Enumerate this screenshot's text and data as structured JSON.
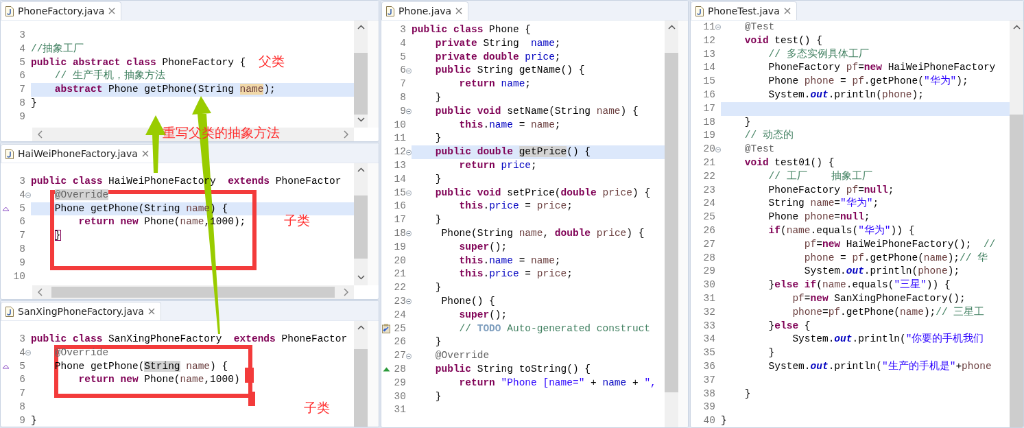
{
  "editors": [
    {
      "tab": {
        "label": "PhoneFactory.java",
        "selected": true
      },
      "lines": [
        {
          "number": "3",
          "current": false
        },
        {
          "number": "4",
          "current": false,
          "tokens": [
            {
              "kind": "comment",
              "text": "//抽象工厂"
            }
          ]
        },
        {
          "number": "5",
          "current": false,
          "tokens": [
            {
              "kind": "keyword",
              "text": "public abstract class"
            },
            {
              "kind": "plain",
              "text": " PhoneFactory {"
            }
          ]
        },
        {
          "number": "6",
          "current": false,
          "tokens": [
            {
              "kind": "comment",
              "text": "    // 生产手机，抽象方法"
            }
          ]
        },
        {
          "number": "7",
          "current": true,
          "tokens": [
            {
              "kind": "keyword",
              "text": "    abstract"
            },
            {
              "kind": "plain",
              "text": " Phone getPhone(String "
            },
            {
              "kind": "variable",
              "text": "name",
              "highlight": {
                "kind": "occurrence"
              }
            },
            {
              "kind": "plain",
              "text": ");"
            }
          ]
        },
        {
          "number": "8",
          "current": false,
          "tokens": [
            {
              "kind": "plain",
              "text": "}"
            }
          ]
        },
        {
          "number": "9",
          "current": false
        }
      ]
    },
    {
      "tab": {
        "label": "HaiWeiPhoneFactory.java",
        "selected": true
      },
      "lines": [
        {
          "number": "3",
          "current": false,
          "tokens": [
            {
              "kind": "keyword",
              "text": "public class"
            },
            {
              "kind": "plain",
              "text": " HaiWeiPhoneFactory  "
            },
            {
              "kind": "keyword",
              "text": "extends"
            },
            {
              "kind": "plain",
              "text": " PhoneFactor"
            }
          ]
        },
        {
          "number": "4",
          "current": false,
          "marker": {
            "kind": "fold"
          },
          "tokens": [
            {
              "kind": "annotation",
              "text": "    @Override",
              "highlight": {
                "kind": "selection"
              }
            }
          ]
        },
        {
          "number": "5",
          "current": true,
          "marker": {
            "kind": "implements"
          },
          "tokens": [
            {
              "kind": "plain",
              "text": "    Phone getPhone(String "
            },
            {
              "kind": "variable",
              "text": "name"
            },
            {
              "kind": "plain",
              "text": ") {"
            }
          ]
        },
        {
          "number": "6",
          "current": false,
          "tokens": [
            {
              "kind": "keyword",
              "text": "        return new"
            },
            {
              "kind": "plain",
              "text": " Phone("
            },
            {
              "kind": "variable",
              "text": "name"
            },
            {
              "kind": "plain",
              "text": ",1000);"
            }
          ]
        },
        {
          "number": "7",
          "current": false,
          "tokens": [
            {
              "kind": "plain",
              "text": "    }",
              "highlight": {
                "kind": "bracket"
              }
            }
          ]
        },
        {
          "number": "8",
          "current": false
        },
        {
          "number": "9",
          "current": false
        },
        {
          "number": "10",
          "current": false
        }
      ]
    },
    {
      "tab": {
        "label": "SanXingPhoneFactory.java",
        "selected": true
      },
      "lines": [
        {
          "number": "3",
          "current": false,
          "tokens": [
            {
              "kind": "keyword",
              "text": "public class"
            },
            {
              "kind": "plain",
              "text": " SanXingPhoneFactory  "
            },
            {
              "kind": "keyword",
              "text": "extends"
            },
            {
              "kind": "plain",
              "text": " PhoneFactor"
            }
          ]
        },
        {
          "number": "4",
          "current": false,
          "marker": {
            "kind": "fold"
          },
          "tokens": [
            {
              "kind": "annotation",
              "text": "    @Override"
            }
          ]
        },
        {
          "number": "5",
          "current": false,
          "marker": {
            "kind": "implements"
          },
          "tokens": [
            {
              "kind": "plain",
              "text": "    Phone getPhone("
            },
            {
              "kind": "plain",
              "text": "String",
              "highlight": {
                "kind": "selection"
              }
            },
            {
              "kind": "variable",
              "text": " name"
            },
            {
              "kind": "plain",
              "text": ") {"
            }
          ]
        },
        {
          "number": "6",
          "current": false,
          "tokens": [
            {
              "kind": "keyword",
              "text": "        return new"
            },
            {
              "kind": "plain",
              "text": " Phone("
            },
            {
              "kind": "variable",
              "text": "name"
            },
            {
              "kind": "plain",
              "text": ",1000)"
            }
          ]
        },
        {
          "number": "7",
          "current": false
        },
        {
          "number": "8",
          "current": false
        },
        {
          "number": "9",
          "current": false,
          "tokens": [
            {
              "kind": "plain",
              "text": "}"
            }
          ]
        }
      ]
    },
    {
      "tab": {
        "label": "Phone.java",
        "selected": true
      },
      "lines": [
        {
          "number": "3",
          "current": false,
          "tokens": [
            {
              "kind": "keyword",
              "text": "public class"
            },
            {
              "kind": "plain",
              "text": " Phone {"
            }
          ]
        },
        {
          "number": "4",
          "current": false,
          "tokens": [
            {
              "kind": "keyword",
              "text": "    private"
            },
            {
              "kind": "plain",
              "text": " String  "
            },
            {
              "kind": "field",
              "text": "name"
            },
            {
              "kind": "plain",
              "text": ";"
            }
          ]
        },
        {
          "number": "5",
          "current": false,
          "tokens": [
            {
              "kind": "keyword",
              "text": "    private double "
            },
            {
              "kind": "field",
              "text": "price"
            },
            {
              "kind": "plain",
              "text": ";"
            }
          ]
        },
        {
          "number": "6",
          "current": false,
          "marker": {
            "kind": "fold"
          },
          "tokens": [
            {
              "kind": "keyword",
              "text": "    public"
            },
            {
              "kind": "plain",
              "text": " String getName() {"
            }
          ]
        },
        {
          "number": "7",
          "current": false,
          "tokens": [
            {
              "kind": "keyword",
              "text": "        return "
            },
            {
              "kind": "field",
              "text": "name"
            },
            {
              "kind": "plain",
              "text": ";"
            }
          ]
        },
        {
          "number": "8",
          "current": false,
          "tokens": [
            {
              "kind": "plain",
              "text": "    }"
            }
          ]
        },
        {
          "number": "9",
          "current": false,
          "marker": {
            "kind": "fold"
          },
          "tokens": [
            {
              "kind": "keyword",
              "text": "    public void"
            },
            {
              "kind": "plain",
              "text": " setName(String "
            },
            {
              "kind": "variable",
              "text": "name"
            },
            {
              "kind": "plain",
              "text": ") {"
            }
          ]
        },
        {
          "number": "10",
          "current": false,
          "tokens": [
            {
              "kind": "keyword",
              "text": "        this"
            },
            {
              "kind": "plain",
              "text": "."
            },
            {
              "kind": "field",
              "text": "name"
            },
            {
              "kind": "plain",
              "text": " = "
            },
            {
              "kind": "variable",
              "text": "name"
            },
            {
              "kind": "plain",
              "text": ";"
            }
          ]
        },
        {
          "number": "11",
          "current": false,
          "tokens": [
            {
              "kind": "plain",
              "text": "    }"
            }
          ]
        },
        {
          "number": "12",
          "current": true,
          "marker": {
            "kind": "fold"
          },
          "tokens": [
            {
              "kind": "keyword",
              "text": "    public double "
            },
            {
              "kind": "plain",
              "text": "getPrice",
              "highlight": {
                "kind": "selection"
              }
            },
            {
              "kind": "plain",
              "text": "() {"
            }
          ]
        },
        {
          "number": "13",
          "current": false,
          "tokens": [
            {
              "kind": "keyword",
              "text": "        return "
            },
            {
              "kind": "field",
              "text": "price"
            },
            {
              "kind": "plain",
              "text": ";"
            }
          ]
        },
        {
          "number": "14",
          "current": false,
          "tokens": [
            {
              "kind": "plain",
              "text": "    }"
            }
          ]
        },
        {
          "number": "15",
          "current": false,
          "marker": {
            "kind": "fold"
          },
          "tokens": [
            {
              "kind": "keyword",
              "text": "    public void"
            },
            {
              "kind": "plain",
              "text": " setPrice("
            },
            {
              "kind": "keyword",
              "text": "double "
            },
            {
              "kind": "variable",
              "text": "price"
            },
            {
              "kind": "plain",
              "text": ") {"
            }
          ]
        },
        {
          "number": "16",
          "current": false,
          "tokens": [
            {
              "kind": "keyword",
              "text": "        this"
            },
            {
              "kind": "plain",
              "text": "."
            },
            {
              "kind": "field",
              "text": "price"
            },
            {
              "kind": "plain",
              "text": " = "
            },
            {
              "kind": "variable",
              "text": "price"
            },
            {
              "kind": "plain",
              "text": ";"
            }
          ]
        },
        {
          "number": "17",
          "current": false,
          "tokens": [
            {
              "kind": "plain",
              "text": "    }"
            }
          ]
        },
        {
          "number": "18",
          "current": false,
          "marker": {
            "kind": "fold"
          },
          "tokens": [
            {
              "kind": "plain",
              "text": "     Phone(String "
            },
            {
              "kind": "variable",
              "text": "name"
            },
            {
              "kind": "plain",
              "text": ", "
            },
            {
              "kind": "keyword",
              "text": "double "
            },
            {
              "kind": "variable",
              "text": "price"
            },
            {
              "kind": "plain",
              "text": ") {"
            }
          ]
        },
        {
          "number": "19",
          "current": false,
          "tokens": [
            {
              "kind": "keyword",
              "text": "        super"
            },
            {
              "kind": "plain",
              "text": "();"
            }
          ]
        },
        {
          "number": "20",
          "current": false,
          "tokens": [
            {
              "kind": "keyword",
              "text": "        this"
            },
            {
              "kind": "plain",
              "text": "."
            },
            {
              "kind": "field",
              "text": "name"
            },
            {
              "kind": "plain",
              "text": " = "
            },
            {
              "kind": "variable",
              "text": "name"
            },
            {
              "kind": "plain",
              "text": ";"
            }
          ]
        },
        {
          "number": "21",
          "current": false,
          "tokens": [
            {
              "kind": "keyword",
              "text": "        this"
            },
            {
              "kind": "plain",
              "text": "."
            },
            {
              "kind": "field",
              "text": "price"
            },
            {
              "kind": "plain",
              "text": " = "
            },
            {
              "kind": "variable",
              "text": "price"
            },
            {
              "kind": "plain",
              "text": ";"
            }
          ]
        },
        {
          "number": "22",
          "current": false,
          "tokens": [
            {
              "kind": "plain",
              "text": "    }"
            }
          ]
        },
        {
          "number": "23",
          "current": false,
          "marker": {
            "kind": "fold"
          },
          "tokens": [
            {
              "kind": "plain",
              "text": "     Phone() {"
            }
          ]
        },
        {
          "number": "24",
          "current": false,
          "tokens": [
            {
              "kind": "keyword",
              "text": "        super"
            },
            {
              "kind": "plain",
              "text": "();"
            }
          ]
        },
        {
          "number": "25",
          "current": false,
          "marker": {
            "kind": "task"
          },
          "tokens": [
            {
              "kind": "comment",
              "text": "        // "
            },
            {
              "kind": "task",
              "text": "TODO"
            },
            {
              "kind": "comment",
              "text": " Auto-generated construct"
            }
          ]
        },
        {
          "number": "26",
          "current": false,
          "tokens": [
            {
              "kind": "plain",
              "text": "    }"
            }
          ]
        },
        {
          "number": "27",
          "current": false,
          "marker": {
            "kind": "fold"
          },
          "tokens": [
            {
              "kind": "annotation",
              "text": "    @Override"
            }
          ]
        },
        {
          "number": "28",
          "current": false,
          "marker": {
            "kind": "override"
          },
          "tokens": [
            {
              "kind": "keyword",
              "text": "    public"
            },
            {
              "kind": "plain",
              "text": " String toString() {"
            }
          ]
        },
        {
          "number": "29",
          "current": false,
          "tokens": [
            {
              "kind": "keyword",
              "text": "        return "
            },
            {
              "kind": "string",
              "text": "\"Phone [name=\""
            },
            {
              "kind": "plain",
              "text": " + "
            },
            {
              "kind": "field",
              "text": "name"
            },
            {
              "kind": "plain",
              "text": " + "
            },
            {
              "kind": "string",
              "text": "\","
            }
          ]
        },
        {
          "number": "30",
          "current": false,
          "tokens": [
            {
              "kind": "plain",
              "text": "    }"
            }
          ]
        },
        {
          "number": "31",
          "current": false
        }
      ]
    },
    {
      "tab": {
        "label": "PhoneTest.java",
        "selected": true
      },
      "lines": [
        {
          "number": "11",
          "current": false,
          "marker": {
            "kind": "fold"
          },
          "tokens": [
            {
              "kind": "annotation",
              "text": "    @Test"
            }
          ]
        },
        {
          "number": "12",
          "current": false,
          "tokens": [
            {
              "kind": "keyword",
              "text": "    void"
            },
            {
              "kind": "plain",
              "text": " test() {"
            }
          ]
        },
        {
          "number": "13",
          "current": false,
          "tokens": [
            {
              "kind": "comment",
              "text": "        // 多态实例具体工厂"
            }
          ]
        },
        {
          "number": "14",
          "current": false,
          "tokens": [
            {
              "kind": "plain",
              "text": "        PhoneFactory "
            },
            {
              "kind": "variable",
              "text": "pf"
            },
            {
              "kind": "plain",
              "text": "="
            },
            {
              "kind": "keyword",
              "text": "new"
            },
            {
              "kind": "plain",
              "text": " HaiWeiPhoneFactory"
            }
          ]
        },
        {
          "number": "15",
          "current": false,
          "tokens": [
            {
              "kind": "plain",
              "text": "        Phone "
            },
            {
              "kind": "variable",
              "text": "phone"
            },
            {
              "kind": "plain",
              "text": " = "
            },
            {
              "kind": "variable",
              "text": "pf"
            },
            {
              "kind": "plain",
              "text": ".getPhone("
            },
            {
              "kind": "string",
              "text": "\"华为\""
            },
            {
              "kind": "plain",
              "text": ");"
            }
          ]
        },
        {
          "number": "16",
          "current": false,
          "tokens": [
            {
              "kind": "plain",
              "text": "        System."
            },
            {
              "kind": "static",
              "text": "out"
            },
            {
              "kind": "plain",
              "text": ".println("
            },
            {
              "kind": "variable",
              "text": "phone"
            },
            {
              "kind": "plain",
              "text": ");"
            }
          ]
        },
        {
          "number": "17",
          "current": true
        },
        {
          "number": "18",
          "current": false,
          "tokens": [
            {
              "kind": "plain",
              "text": "    }"
            }
          ]
        },
        {
          "number": "19",
          "current": false,
          "tokens": [
            {
              "kind": "comment",
              "text": "    // 动态的"
            }
          ]
        },
        {
          "number": "20",
          "current": false,
          "marker": {
            "kind": "fold"
          },
          "tokens": [
            {
              "kind": "annotation",
              "text": "    @Test"
            }
          ]
        },
        {
          "number": "21",
          "current": false,
          "tokens": [
            {
              "kind": "keyword",
              "text": "    void"
            },
            {
              "kind": "plain",
              "text": " test01() {"
            }
          ]
        },
        {
          "number": "22",
          "current": false,
          "tokens": [
            {
              "kind": "comment",
              "text": "        // 工厂    抽象工厂"
            }
          ]
        },
        {
          "number": "23",
          "current": false,
          "tokens": [
            {
              "kind": "plain",
              "text": "        PhoneFactory "
            },
            {
              "kind": "variable",
              "text": "pf"
            },
            {
              "kind": "plain",
              "text": "="
            },
            {
              "kind": "keyword",
              "text": "null"
            },
            {
              "kind": "plain",
              "text": ";"
            }
          ]
        },
        {
          "number": "24",
          "current": false,
          "tokens": [
            {
              "kind": "plain",
              "text": "        String "
            },
            {
              "kind": "variable",
              "text": "name"
            },
            {
              "kind": "plain",
              "text": "="
            },
            {
              "kind": "string",
              "text": "\"华为\""
            },
            {
              "kind": "plain",
              "text": ";"
            }
          ]
        },
        {
          "number": "25",
          "current": false,
          "tokens": [
            {
              "kind": "plain",
              "text": "        Phone "
            },
            {
              "kind": "variable",
              "text": "phone"
            },
            {
              "kind": "plain",
              "text": "="
            },
            {
              "kind": "keyword",
              "text": "null"
            },
            {
              "kind": "plain",
              "text": ";"
            }
          ]
        },
        {
          "number": "26",
          "current": false,
          "tokens": [
            {
              "kind": "keyword",
              "text": "        if"
            },
            {
              "kind": "plain",
              "text": "("
            },
            {
              "kind": "variable",
              "text": "name"
            },
            {
              "kind": "plain",
              "text": ".equals("
            },
            {
              "kind": "string",
              "text": "\"华为\""
            },
            {
              "kind": "plain",
              "text": ")) {"
            }
          ]
        },
        {
          "number": "27",
          "current": false,
          "tokens": [
            {
              "kind": "variable",
              "text": "              pf"
            },
            {
              "kind": "plain",
              "text": "="
            },
            {
              "kind": "keyword",
              "text": "new"
            },
            {
              "kind": "plain",
              "text": " HaiWeiPhoneFactory();  "
            },
            {
              "kind": "comment",
              "text": "//"
            }
          ]
        },
        {
          "number": "28",
          "current": false,
          "tokens": [
            {
              "kind": "variable",
              "text": "              phone"
            },
            {
              "kind": "plain",
              "text": " = "
            },
            {
              "kind": "variable",
              "text": "pf"
            },
            {
              "kind": "plain",
              "text": ".getPhone("
            },
            {
              "kind": "variable",
              "text": "name"
            },
            {
              "kind": "plain",
              "text": ");"
            },
            {
              "kind": "comment",
              "text": "// 华"
            }
          ]
        },
        {
          "number": "29",
          "current": false,
          "tokens": [
            {
              "kind": "plain",
              "text": "              System."
            },
            {
              "kind": "static",
              "text": "out"
            },
            {
              "kind": "plain",
              "text": ".println("
            },
            {
              "kind": "variable",
              "text": "phone"
            },
            {
              "kind": "plain",
              "text": ");"
            }
          ]
        },
        {
          "number": "30",
          "current": false,
          "tokens": [
            {
              "kind": "plain",
              "text": "        }"
            },
            {
              "kind": "keyword",
              "text": "else if"
            },
            {
              "kind": "plain",
              "text": "("
            },
            {
              "kind": "variable",
              "text": "name"
            },
            {
              "kind": "plain",
              "text": ".equals("
            },
            {
              "kind": "string",
              "text": "\"三星\""
            },
            {
              "kind": "plain",
              "text": ")) {"
            }
          ]
        },
        {
          "number": "31",
          "current": false,
          "tokens": [
            {
              "kind": "variable",
              "text": "            pf"
            },
            {
              "kind": "plain",
              "text": "="
            },
            {
              "kind": "keyword",
              "text": "new"
            },
            {
              "kind": "plain",
              "text": " SanXingPhoneFactory();"
            }
          ]
        },
        {
          "number": "32",
          "current": false,
          "tokens": [
            {
              "kind": "variable",
              "text": "            phone"
            },
            {
              "kind": "plain",
              "text": "="
            },
            {
              "kind": "variable",
              "text": "pf"
            },
            {
              "kind": "plain",
              "text": ".getPhone("
            },
            {
              "kind": "variable",
              "text": "name"
            },
            {
              "kind": "plain",
              "text": ");"
            },
            {
              "kind": "comment",
              "text": "// 三星工"
            }
          ]
        },
        {
          "number": "33",
          "current": false,
          "tokens": [
            {
              "kind": "plain",
              "text": "        }"
            },
            {
              "kind": "keyword",
              "text": "else"
            },
            {
              "kind": "plain",
              "text": " {"
            }
          ]
        },
        {
          "number": "34",
          "current": false,
          "tokens": [
            {
              "kind": "plain",
              "text": "            System."
            },
            {
              "kind": "static",
              "text": "out"
            },
            {
              "kind": "plain",
              "text": ".println("
            },
            {
              "kind": "string",
              "text": "\"你要的手机我们"
            }
          ]
        },
        {
          "number": "35",
          "current": false,
          "tokens": [
            {
              "kind": "plain",
              "text": "        }"
            }
          ]
        },
        {
          "number": "36",
          "current": false,
          "tokens": [
            {
              "kind": "plain",
              "text": "        System."
            },
            {
              "kind": "static",
              "text": "out"
            },
            {
              "kind": "plain",
              "text": ".println("
            },
            {
              "kind": "string",
              "text": "\"生产的手机是\""
            },
            {
              "kind": "plain",
              "text": "+"
            },
            {
              "kind": "variable",
              "text": "phone"
            }
          ]
        },
        {
          "number": "37",
          "current": false
        },
        {
          "number": "38",
          "current": false,
          "tokens": [
            {
              "kind": "plain",
              "text": "    }"
            }
          ]
        },
        {
          "number": "39",
          "current": false
        },
        {
          "number": "40",
          "current": false,
          "tokens": [
            {
              "kind": "plain",
              "text": "}"
            }
          ]
        }
      ]
    }
  ],
  "annotations": [
    {
      "text": "父类"
    },
    {
      "text": "重写父类的抽象方法"
    },
    {
      "text": "子类"
    },
    {
      "text": "子类"
    }
  ]
}
